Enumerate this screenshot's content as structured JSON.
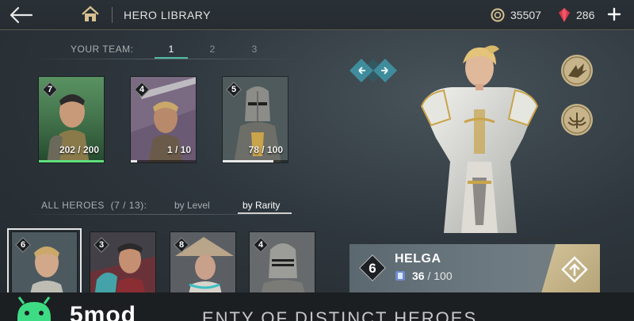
{
  "header": {
    "title": "HERO LIBRARY",
    "coins": "35507",
    "gems": "286",
    "icons": {
      "back": "back-arrow-icon",
      "home": "home-icon",
      "coin": "coin-icon",
      "gem": "gem-icon",
      "add": "plus-icon"
    }
  },
  "team": {
    "label": "YOUR TEAM:",
    "tabs": [
      "1",
      "2",
      "3"
    ],
    "active_tab": "1",
    "cards": [
      {
        "level": "7",
        "progress": "202 / 200",
        "fraction": 1.0,
        "tint": "#3f7a4c"
      },
      {
        "level": "4",
        "progress": "1 / 10",
        "fraction": 0.1,
        "tint": "#6b5a73"
      },
      {
        "level": "5",
        "progress": "78 / 100",
        "fraction": 0.78,
        "tint": "#4e5a5c"
      }
    ]
  },
  "all_heroes": {
    "label": "ALL HEROES",
    "count": "(7 / 13):",
    "sort_options": [
      "by Level",
      "by Rarity"
    ],
    "active_sort": "by Rarity",
    "cards": [
      {
        "level": "6",
        "tint": "#4c5a60",
        "selected": true
      },
      {
        "level": "3",
        "tint": "#6a3238"
      },
      {
        "level": "8",
        "tint": "#5b5e63"
      },
      {
        "level": "4",
        "tint": "#666a6d"
      }
    ]
  },
  "selected_hero": {
    "name": "HELGA",
    "level": "6",
    "progress_current": "36",
    "progress_total": "/ 100",
    "icons": {
      "upgrade": "upgrade-arrow-icon",
      "cards": "hero-card-icon"
    }
  },
  "side_buttons": [
    "swap-arrows-icon",
    "eagle-emblem-icon",
    "wings-emblem-icon"
  ],
  "watermark": {
    "brand": "5mod",
    "tagline": "ENTY OF DISTINCT HEROES"
  },
  "colors": {
    "accent_teal": "#4fb9a6",
    "gold": "#d4c39a",
    "gem_red": "#d6384a",
    "full_bar_green": "#5fe07f"
  }
}
